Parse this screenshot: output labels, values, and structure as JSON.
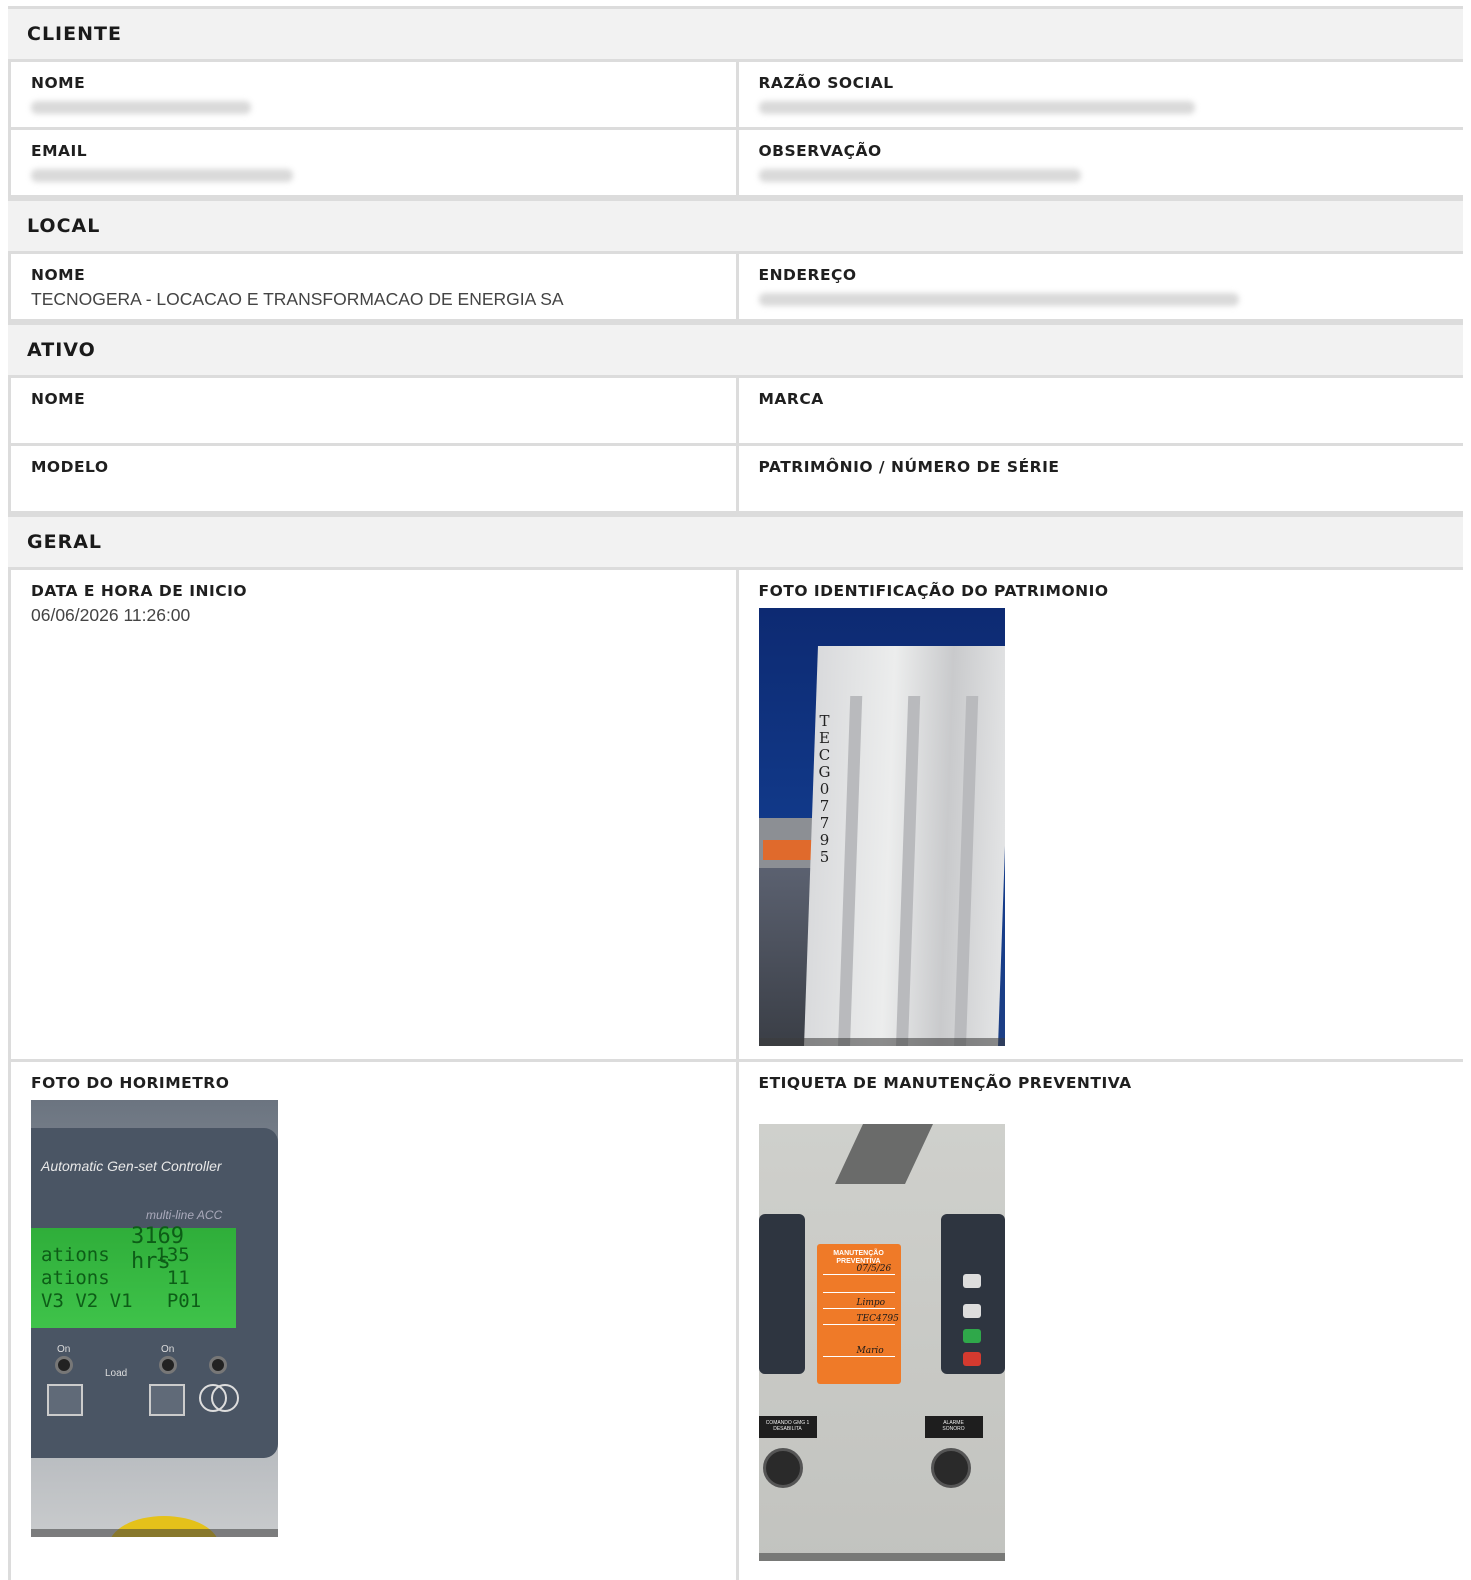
{
  "cliente": {
    "title": "CLIENTE",
    "nome_label": "NOME",
    "razao_label": "RAZÃO SOCIAL",
    "email_label": "EMAIL",
    "obs_label": "OBSERVAÇÃO"
  },
  "local": {
    "title": "LOCAL",
    "nome_label": "NOME",
    "nome_value": "TECNOGERA - LOCACAO E TRANSFORMACAO DE ENERGIA SA",
    "endereco_label": "ENDEREÇO"
  },
  "ativo": {
    "title": "ATIVO",
    "nome_label": "NOME",
    "marca_label": "MARCA",
    "modelo_label": "MODELO",
    "patrimonio_label": "PATRIMÔNIO / NÚMERO DE SÉRIE"
  },
  "geral": {
    "title": "GERAL",
    "inicio_label": "DATA E HORA DE INICIO",
    "inicio_value": "06/06/2026 11:26:00",
    "foto_patrimonio_label": "FOTO IDENTIFICAÇÃO DO PATRIMONIO",
    "foto_horimetro_label": "FOTO DO HORIMETRO",
    "etiqueta_label": "ETIQUETA DE MANUTENÇÃO PREVENTIVA"
  },
  "photo_patrimonio": {
    "container_code": "TECG07795"
  },
  "photo_horimetro": {
    "controller": "Automatic Gen-set Controller",
    "model": "multi-line ACC",
    "hours": "3169 hrs",
    "lcd_lines": "ations    135\nations     11\nV3 V2 V1   P01",
    "on_left": "On",
    "on_right": "On",
    "load": "Load"
  },
  "photo_etiqueta": {
    "tag_title": "MANUTENÇÃO\nPREVENTIVA",
    "hw_data": "07/5/26",
    "hw_condicao": "Limpo",
    "hw_patrimonio": "TEC4795",
    "hw_resp": "Mario",
    "label_left": "COMANDO GMG 1\nDESABILITA",
    "label_right": "ALARME\nSONORO"
  }
}
